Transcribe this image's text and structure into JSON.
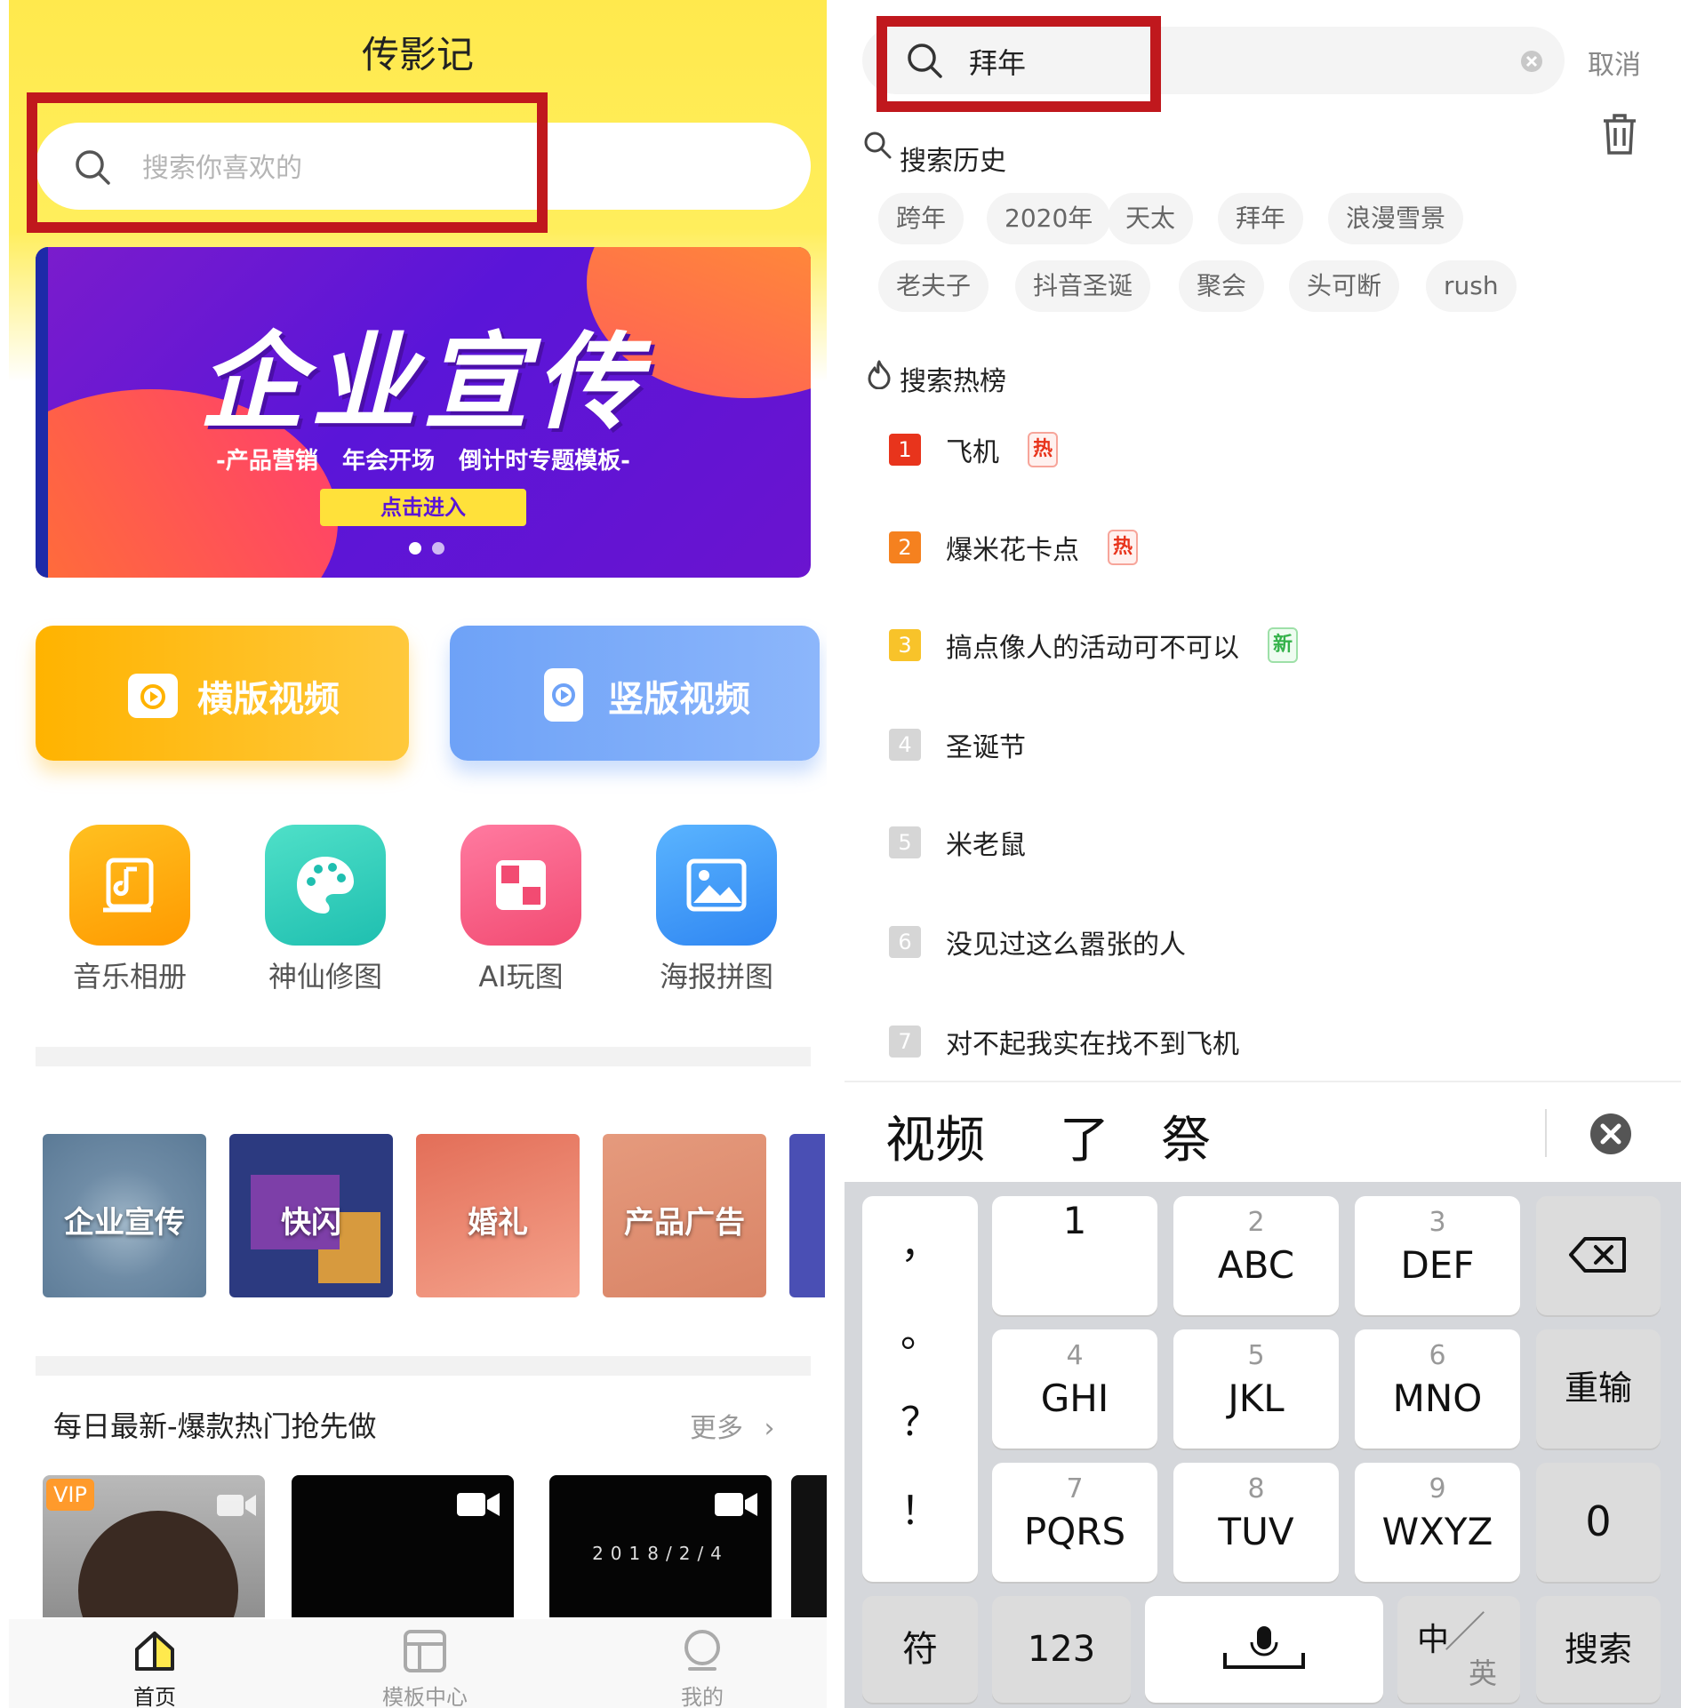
{
  "left": {
    "app_title": "传影记",
    "search_placeholder": "搜索你喜欢的",
    "banner": {
      "title": "企业宣传",
      "subtitle": "-产品营销   年会开场   倒计时专题模板-",
      "cta": "点击进入"
    },
    "big_buttons": {
      "horizontal": "横版视频",
      "vertical": "竖版视频"
    },
    "tools": [
      {
        "label": "音乐相册",
        "icon": "music-album-icon"
      },
      {
        "label": "神仙修图",
        "icon": "palette-icon"
      },
      {
        "label": "AI玩图",
        "icon": "ai-grid-icon"
      },
      {
        "label": "海报拼图",
        "icon": "image-icon"
      }
    ],
    "categories": [
      "企业宣传",
      "快闪",
      "婚礼",
      "产品广告"
    ],
    "section": {
      "title": "每日最新-爆款热门抢先做",
      "more": "更多"
    },
    "video_cards": {
      "vip": "VIP",
      "date": "2018/2/4"
    },
    "tabbar": [
      "首页",
      "模板中心",
      "我的"
    ]
  },
  "right": {
    "search_value": "拜年",
    "cancel": "取消",
    "history_title": "搜索历史",
    "history_row1": [
      "跨年",
      "2020年",
      "天太",
      "拜年",
      "浪漫雪景"
    ],
    "history_row2": [
      "老夫子",
      "抖音圣诞",
      "聚会",
      "头可断",
      "rush"
    ],
    "hot_title": "搜索热榜",
    "hot": [
      {
        "rank": "1",
        "text": "飞机",
        "badge": "热"
      },
      {
        "rank": "2",
        "text": "爆米花卡点",
        "badge": "热"
      },
      {
        "rank": "3",
        "text": "搞点像人的活动可不可以",
        "badge": "新"
      },
      {
        "rank": "4",
        "text": "圣诞节",
        "badge": ""
      },
      {
        "rank": "5",
        "text": "米老鼠",
        "badge": ""
      },
      {
        "rank": "6",
        "text": "没见过这么嚣张的人",
        "badge": ""
      },
      {
        "rank": "7",
        "text": "对不起我实在找不到飞机",
        "badge": ""
      }
    ],
    "candidates": [
      "视频",
      "了",
      "祭"
    ],
    "keyboard": {
      "punct": [
        "，",
        "。",
        "？",
        "！"
      ],
      "k1": {
        "num": "",
        "letters": "1"
      },
      "k2": {
        "num": "2",
        "letters": "ABC"
      },
      "k3": {
        "num": "3",
        "letters": "DEF"
      },
      "k4": {
        "num": "4",
        "letters": "GHI"
      },
      "k5": {
        "num": "5",
        "letters": "JKL"
      },
      "k6": {
        "num": "6",
        "letters": "MNO"
      },
      "k7": {
        "num": "7",
        "letters": "PQRS"
      },
      "k8": {
        "num": "8",
        "letters": "TUV"
      },
      "k9": {
        "num": "9",
        "letters": "WXYZ"
      },
      "reenter": "重输",
      "zero": "0",
      "symbol": "符",
      "num123": "123",
      "lang_zh": "中",
      "lang_en": "英",
      "search": "搜索"
    }
  },
  "colors": {
    "brand_yellow": "#ffe94d",
    "highlight_red": "#c0181d",
    "rank1": "#e8341c",
    "rank2": "#f5811f",
    "rank3": "#f8c32a",
    "rank_other": "#d6d6d6",
    "hot_badge": "#e8341c",
    "new_badge": "#35b24a"
  }
}
